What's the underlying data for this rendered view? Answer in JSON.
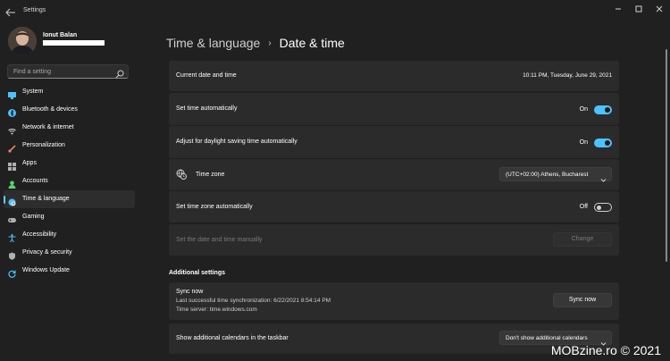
{
  "window": {
    "title": "Settings"
  },
  "user": {
    "name": "Ionut Balan"
  },
  "search": {
    "placeholder": "Find a setting"
  },
  "nav": [
    {
      "label": "System",
      "icon": "system-icon",
      "color": "#4cc2ff"
    },
    {
      "label": "Bluetooth & devices",
      "icon": "bluetooth-icon",
      "color": "#4cc2ff"
    },
    {
      "label": "Network & internet",
      "icon": "wifi-icon",
      "color": "#dcdcdc"
    },
    {
      "label": "Personalization",
      "icon": "brush-icon",
      "color": "#f0a060"
    },
    {
      "label": "Apps",
      "icon": "apps-icon",
      "color": "#b0b0b0"
    },
    {
      "label": "Accounts",
      "icon": "accounts-icon",
      "color": "#5ad46e"
    },
    {
      "label": "Time & language",
      "icon": "globe-clock-icon",
      "color": "#4cc2ff",
      "active": true
    },
    {
      "label": "Gaming",
      "icon": "gamepad-icon",
      "color": "#b0b0b0"
    },
    {
      "label": "Accessibility",
      "icon": "accessibility-icon",
      "color": "#4cc2ff"
    },
    {
      "label": "Privacy & security",
      "icon": "shield-icon",
      "color": "#b0b0b0"
    },
    {
      "label": "Windows Update",
      "icon": "update-icon",
      "color": "#4cc2ff"
    }
  ],
  "breadcrumb": {
    "parent": "Time & language",
    "separator": "›",
    "current": "Date & time"
  },
  "settings": {
    "current": {
      "label": "Current date and time",
      "value": "10:11 PM, Tuesday, June 29, 2021"
    },
    "set_time_auto": {
      "label": "Set time automatically",
      "state": "On"
    },
    "dst": {
      "label": "Adjust for daylight saving time automatically",
      "state": "On"
    },
    "timezone": {
      "label": "Time zone",
      "value": "(UTC+02:00) Athens, Bucharest"
    },
    "tz_auto": {
      "label": "Set time zone automatically",
      "state": "Off"
    },
    "manual": {
      "label": "Set the date and time manually",
      "button": "Change"
    }
  },
  "additional": {
    "title": "Additional settings",
    "sync": {
      "label": "Sync now",
      "last": "Last successful time synchronization: 6/22/2021 8:54:14 PM",
      "server": "Time server: time.windows.com",
      "button": "Sync now"
    },
    "calendars": {
      "label": "Show additional calendars in the taskbar",
      "value": "Don't show additional calendars"
    }
  },
  "watermark": "MOBzine.ro © 2021",
  "colors": {
    "accent": "#4cc2ff",
    "background": "#202020",
    "card": "#2b2b2b"
  }
}
